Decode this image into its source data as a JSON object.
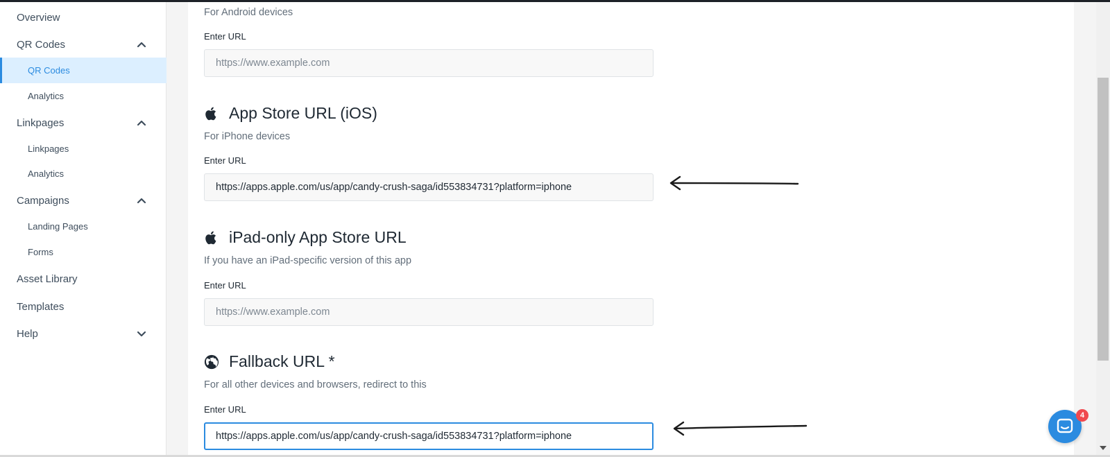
{
  "sidebar": {
    "items": [
      {
        "label": "Overview"
      },
      {
        "label": "QR Codes",
        "expanded": true,
        "children": [
          {
            "label": "QR Codes",
            "active": true
          },
          {
            "label": "Analytics"
          }
        ]
      },
      {
        "label": "Linkpages",
        "expanded": true,
        "children": [
          {
            "label": "Linkpages"
          },
          {
            "label": "Analytics"
          }
        ]
      },
      {
        "label": "Campaigns",
        "expanded": true,
        "children": [
          {
            "label": "Landing Pages"
          },
          {
            "label": "Forms"
          }
        ]
      },
      {
        "label": "Asset Library"
      },
      {
        "label": "Templates"
      },
      {
        "label": "Help",
        "expanded": false
      }
    ]
  },
  "main": {
    "android": {
      "subtitle": "For Android devices",
      "enter_label": "Enter URL",
      "placeholder": "https://www.example.com",
      "value": ""
    },
    "ios": {
      "title": "App Store URL (iOS)",
      "icon": "apple-icon",
      "subtitle": "For iPhone devices",
      "enter_label": "Enter URL",
      "placeholder": "https://www.example.com",
      "value": "https://apps.apple.com/us/app/candy-crush-saga/id553834731?platform=iphone"
    },
    "ipad": {
      "title": "iPad-only App Store URL",
      "icon": "apple-icon",
      "subtitle": "If you have an iPad-specific version of this app",
      "enter_label": "Enter URL",
      "placeholder": "https://www.example.com",
      "value": ""
    },
    "fallback": {
      "title": "Fallback URL *",
      "icon": "globe-icon",
      "subtitle": "For all other devices and browsers, redirect to this",
      "enter_label": "Enter URL",
      "placeholder": "https://www.example.com",
      "value": "https://apps.apple.com/us/app/candy-crush-saga/id553834731?platform=iphone"
    }
  },
  "chat": {
    "badge_count": "4",
    "icon": "chat-icon"
  },
  "colors": {
    "accent": "#2b8be0",
    "active_bg": "#dcefff",
    "badge": "#f0494f"
  }
}
